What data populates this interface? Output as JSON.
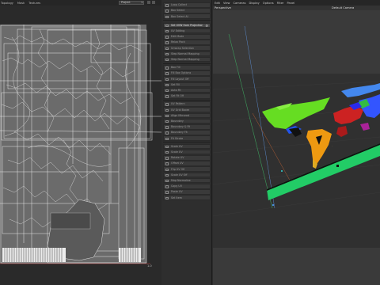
{
  "uv_editor": {
    "menu": [
      "Topology",
      "Mask",
      "Textures"
    ],
    "project_dropdown": "Project",
    "scale_value": "1.0"
  },
  "stack": {
    "items": [
      {
        "label": "Loop Collect",
        "active": false
      },
      {
        "label": "Box Select",
        "active": false
      },
      {
        "label": "Box Select All",
        "active": false
      },
      {
        "label": "Set UVW from Projection",
        "active": true
      },
      {
        "label": "UV Editing",
        "active": false
      },
      {
        "label": "Edit Mode",
        "active": false
      },
      {
        "label": "Relax Pack",
        "active": false
      },
      {
        "label": "Unwrap Selection",
        "active": false
      },
      {
        "label": "Step Normal Mapping",
        "active": false
      },
      {
        "label": "Step Normal Mapping",
        "active": false
      },
      {
        "label": "Box Fill",
        "active": false
      },
      {
        "label": "Fill Box Options",
        "active": false
      },
      {
        "label": "Fill Layout Off",
        "active": false
      },
      {
        "label": "Set Fill",
        "active": false
      },
      {
        "label": "Auto Fit",
        "active": false
      },
      {
        "label": "Set Fit Off",
        "active": false
      },
      {
        "label": "UV Pattern",
        "active": false
      },
      {
        "label": "UV Grid Boxes",
        "active": false
      },
      {
        "label": "Align Mirrored",
        "active": false
      },
      {
        "label": "Boundary",
        "active": false
      },
      {
        "label": "Boundary & Fit",
        "active": false
      },
      {
        "label": "Boundary Fit",
        "active": false
      },
      {
        "label": "Fit Stroke",
        "active": false
      },
      {
        "label": "Scale UV",
        "active": false
      },
      {
        "label": "Scale UV",
        "active": false
      },
      {
        "label": "Rotate UV",
        "active": false
      },
      {
        "label": "Offset UV",
        "active": false
      },
      {
        "label": "Flip UV Off",
        "active": false
      },
      {
        "label": "Scale UV Off",
        "active": false
      },
      {
        "label": "Map Normalize",
        "active": false
      },
      {
        "label": "Copy UV",
        "active": false
      },
      {
        "label": "Paste UV",
        "active": false
      },
      {
        "label": "Set Item",
        "active": false
      }
    ]
  },
  "viewport": {
    "menu": [
      "Edit",
      "View",
      "Cameras",
      "Display",
      "Options",
      "Filter",
      "Panel"
    ],
    "view_label": "Perspective",
    "camera_label": "Default Camera"
  }
}
